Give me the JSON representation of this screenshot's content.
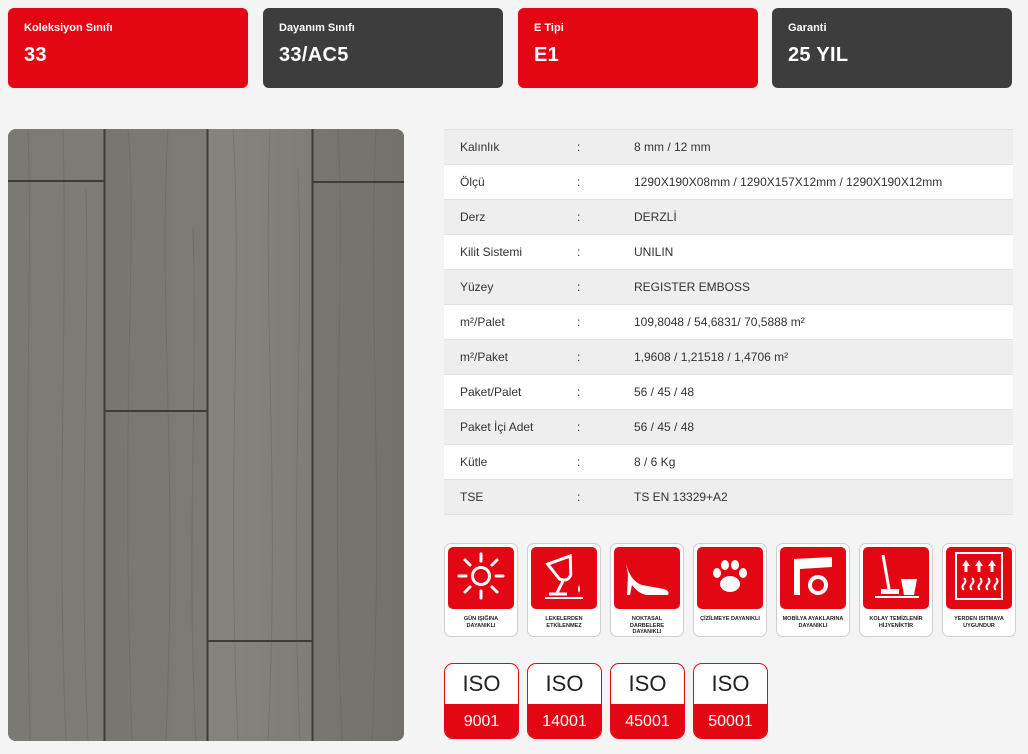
{
  "cards": [
    {
      "label": "Koleksiyon Sınıfı",
      "value": "33",
      "color": "#e30613"
    },
    {
      "label": "Dayanım Sınıfı",
      "value": "33/AC5",
      "color": "#3d3d3d"
    },
    {
      "label": "E Tipi",
      "value": "E1",
      "color": "#e30613"
    },
    {
      "label": "Garanti",
      "value": "25 YIL",
      "color": "#3d3d3d"
    }
  ],
  "specs": [
    {
      "key": "Kalınlık",
      "sep": ":",
      "value": "8 mm / 12 mm"
    },
    {
      "key": "Ölçü",
      "sep": ":",
      "value": "1290X190X08mm / 1290X157X12mm / 1290X190X12mm"
    },
    {
      "key": "Derz",
      "sep": ":",
      "value": "DERZLİ"
    },
    {
      "key": "Kilit Sistemi",
      "sep": ":",
      "value": "UNILIN"
    },
    {
      "key": "Yüzey",
      "sep": ":",
      "value": "REGISTER EMBOSS"
    },
    {
      "key": "m²/Palet",
      "sep": ":",
      "value": "109,8048 / 54,6831/ 70,5888 m²"
    },
    {
      "key": "m²/Paket",
      "sep": ":",
      "value": "1,9608 / 1,21518 / 1,4706 m²"
    },
    {
      "key": "Paket/Palet",
      "sep": ":",
      "value": "56 / 45 / 48"
    },
    {
      "key": "Paket İçi Adet",
      "sep": ":",
      "value": "56 / 45 / 48"
    },
    {
      "key": "Kütle",
      "sep": ":",
      "value": "8 / 6 Kg"
    },
    {
      "key": "TSE",
      "sep": ":",
      "value": "TS EN 13329+A2"
    }
  ],
  "badges": [
    {
      "icon": "sun-icon",
      "label": "GÜN IŞIĞINA DAYANIKLI"
    },
    {
      "icon": "spilled-glass-icon",
      "label": "LEKELERDEN ETKİLENMEZ"
    },
    {
      "icon": "high-heel-icon",
      "label": "NOKTASAL DARBELERE DAYANIKLI"
    },
    {
      "icon": "paw-icon",
      "label": "ÇİZİLMEYE DAYANIKLI"
    },
    {
      "icon": "furniture-leg-icon",
      "label": "MOBİLYA AYAKLARINA DAYANIKLI"
    },
    {
      "icon": "mop-bucket-icon",
      "label": "KOLAY TEMİZLENİR HİJYENİKTİR"
    },
    {
      "icon": "floor-heating-icon",
      "label": "YERDEN ISITMAYA UYGUNDUR"
    }
  ],
  "iso": [
    {
      "top": "ISO",
      "number": "9001"
    },
    {
      "top": "ISO",
      "number": "14001"
    },
    {
      "top": "ISO",
      "number": "45001"
    },
    {
      "top": "ISO",
      "number": "50001"
    }
  ],
  "colors": {
    "accent": "#e30613",
    "dark": "#3d3d3d"
  }
}
